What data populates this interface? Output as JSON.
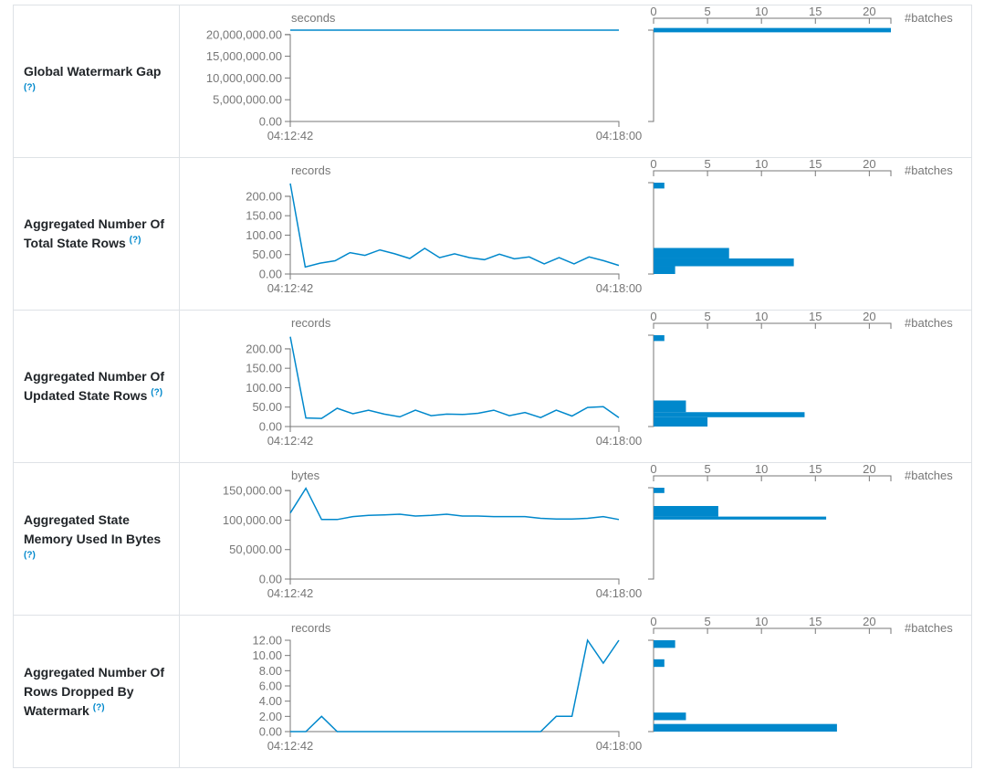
{
  "histogram_axis": {
    "ticks": [
      "0",
      "5",
      "10",
      "15",
      "20"
    ],
    "unit": "#batches",
    "max": 22
  },
  "time_axis": {
    "start": "04:12:42",
    "end": "04:18:00"
  },
  "colors": {
    "series": "#0088cc",
    "axis": "#777777",
    "text": "#212529",
    "help": "#0088cc"
  },
  "rows": [
    {
      "label": "Global Watermark Gap",
      "help": "(?)",
      "unit": "seconds",
      "ytick_labels": [
        "20,000,000.00",
        "15,000,000.00",
        "10,000,000.00",
        "5,000,000.00",
        "0.00"
      ],
      "ytick_values": [
        20000000,
        15000000,
        10000000,
        5000000,
        0
      ],
      "ymax": 21000000
    },
    {
      "label": "Aggregated Number Of Total State Rows",
      "help": "(?)",
      "unit": "records",
      "ytick_labels": [
        "200.00",
        "150.00",
        "100.00",
        "50.00",
        "0.00"
      ],
      "ytick_values": [
        200,
        150,
        100,
        50,
        0
      ],
      "ymax": 235
    },
    {
      "label": "Aggregated Number Of Updated State Rows",
      "help": "(?)",
      "unit": "records",
      "ytick_labels": [
        "200.00",
        "150.00",
        "100.00",
        "50.00",
        "0.00"
      ],
      "ytick_values": [
        200,
        150,
        100,
        50,
        0
      ],
      "ymax": 235
    },
    {
      "label": "Aggregated State Memory Used In Bytes",
      "help": "(?)",
      "unit": "bytes",
      "ytick_labels": [
        "150,000.00",
        "100,000.00",
        "50,000.00",
        "0.00"
      ],
      "ytick_values": [
        150000,
        100000,
        50000,
        0
      ],
      "ymax": 155000
    },
    {
      "label": "Aggregated Number Of Rows Dropped By Watermark",
      "help": "(?)",
      "unit": "records",
      "ytick_labels": [
        "12.00",
        "10.00",
        "8.00",
        "6.00",
        "4.00",
        "2.00",
        "0.00"
      ],
      "ytick_values": [
        12,
        10,
        8,
        6,
        4,
        2,
        0
      ],
      "ymax": 12
    }
  ],
  "chart_data": [
    {
      "type": "line",
      "title": "Global Watermark Gap",
      "ylabel": "seconds",
      "xlabel": "",
      "xlim": [
        "04:12:42",
        "04:18:00"
      ],
      "ylim": [
        0,
        21000000
      ],
      "values": [
        21000000,
        21000000,
        21000000,
        21000000,
        21000000,
        21000000,
        21000000,
        21000000,
        21000000,
        21000000,
        21000000,
        21000000,
        21000000,
        21000000,
        21000000,
        21000000,
        21000000,
        21000000,
        21000000,
        21000000,
        21000000,
        21000000
      ],
      "histogram": {
        "bins": [
          {
            "lo": 20500000,
            "hi": 21500000,
            "count": 22
          }
        ]
      }
    },
    {
      "type": "line",
      "title": "Aggregated Number Of Total State Rows",
      "ylabel": "records",
      "xlabel": "",
      "xlim": [
        "04:12:42",
        "04:18:00"
      ],
      "ylim": [
        0,
        235
      ],
      "values": [
        233,
        18,
        28,
        34,
        55,
        48,
        62,
        52,
        40,
        66,
        42,
        52,
        42,
        37,
        51,
        39,
        44,
        26,
        42,
        26,
        44,
        34,
        22
      ],
      "histogram": {
        "bins": [
          {
            "lo": 220,
            "hi": 235,
            "count": 1
          },
          {
            "lo": 40,
            "hi": 67,
            "count": 7
          },
          {
            "lo": 20,
            "hi": 40,
            "count": 13
          },
          {
            "lo": 0,
            "hi": 20,
            "count": 2
          }
        ]
      }
    },
    {
      "type": "line",
      "title": "Aggregated Number Of Updated State Rows",
      "ylabel": "records",
      "xlabel": "",
      "xlim": [
        "04:12:42",
        "04:18:00"
      ],
      "ylim": [
        0,
        235
      ],
      "values": [
        231,
        22,
        21,
        47,
        33,
        42,
        32,
        25,
        42,
        28,
        32,
        31,
        34,
        42,
        28,
        36,
        23,
        42,
        27,
        49,
        51,
        23
      ],
      "histogram": {
        "bins": [
          {
            "lo": 220,
            "hi": 235,
            "count": 1
          },
          {
            "lo": 37,
            "hi": 67,
            "count": 3
          },
          {
            "lo": 24,
            "hi": 37,
            "count": 14
          },
          {
            "lo": 0,
            "hi": 24,
            "count": 5
          }
        ]
      }
    },
    {
      "type": "line",
      "title": "Aggregated State Memory Used In Bytes",
      "ylabel": "bytes",
      "xlabel": "",
      "xlim": [
        "04:12:42",
        "04:18:00"
      ],
      "ylim": [
        0,
        155000
      ],
      "values": [
        112000,
        154000,
        101000,
        101000,
        106000,
        108000,
        109000,
        110000,
        107000,
        108000,
        110000,
        107000,
        107000,
        106000,
        106000,
        106000,
        103000,
        102000,
        102000,
        103000,
        106000,
        101000
      ],
      "histogram": {
        "bins": [
          {
            "lo": 146000,
            "hi": 155000,
            "count": 1
          },
          {
            "lo": 106000,
            "hi": 124000,
            "count": 6
          },
          {
            "lo": 101000,
            "hi": 106000,
            "count": 16
          }
        ]
      }
    },
    {
      "type": "line",
      "title": "Aggregated Number Of Rows Dropped By Watermark",
      "ylabel": "records",
      "xlabel": "",
      "xlim": [
        "04:12:42",
        "04:18:00"
      ],
      "ylim": [
        0,
        12
      ],
      "values": [
        0,
        0,
        2,
        0,
        0,
        0,
        0,
        0,
        0,
        0,
        0,
        0,
        0,
        0,
        0,
        0,
        0,
        2,
        2,
        12,
        9,
        12
      ],
      "histogram": {
        "bins": [
          {
            "lo": 11,
            "hi": 12,
            "count": 2
          },
          {
            "lo": 8.5,
            "hi": 9.5,
            "count": 1
          },
          {
            "lo": 1.5,
            "hi": 2.5,
            "count": 3
          },
          {
            "lo": 0,
            "hi": 1,
            "count": 17
          }
        ]
      }
    }
  ]
}
